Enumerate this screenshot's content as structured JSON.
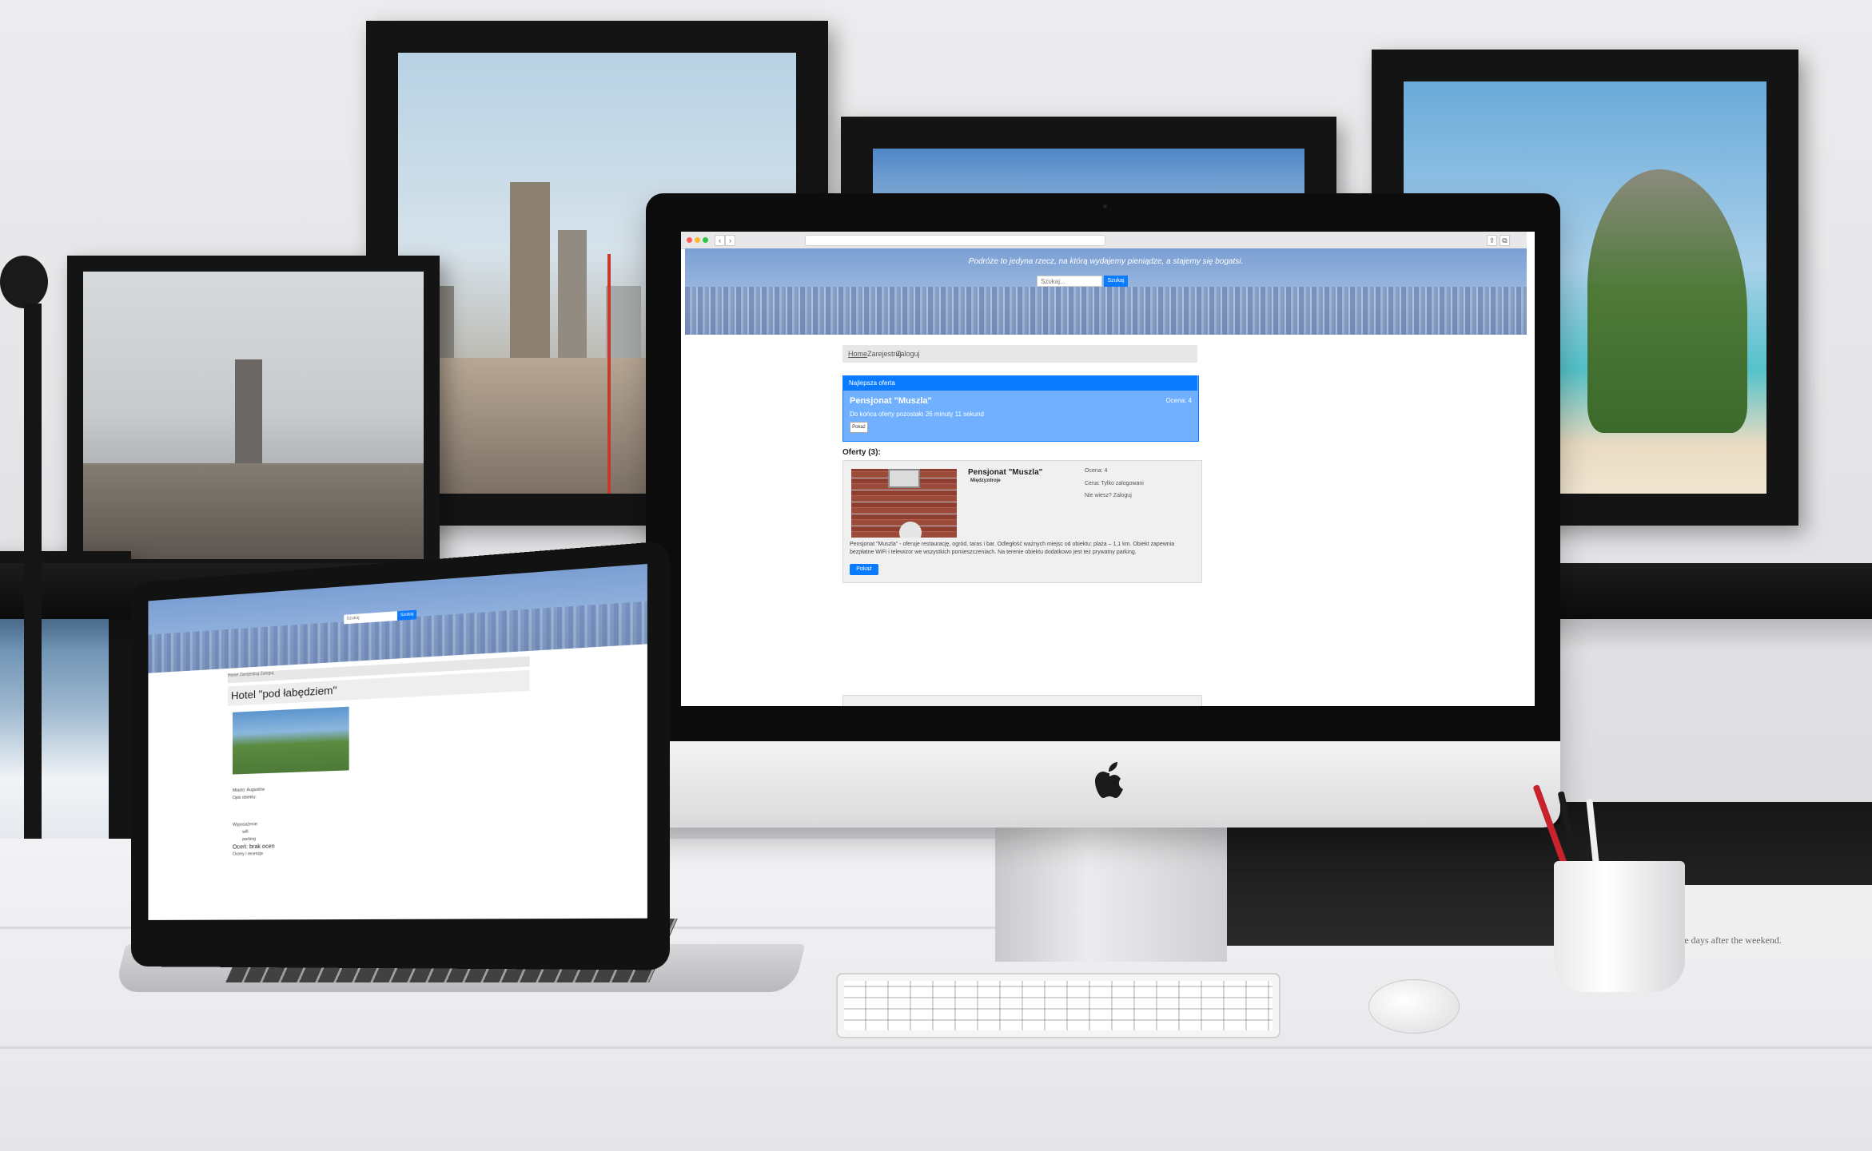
{
  "colors": {
    "primary": "#0a7bff",
    "featured_bg": "#70b0ff",
    "navbar_bg": "#e7e7e7",
    "card_bg": "#f0f0f0",
    "hero_blue": "#7c9fd3"
  },
  "imac": {
    "hero": {
      "tagline": "Podróże to jedyna rzecz, na którą wydajemy pieniądze, a stajemy się bogatsi.",
      "search_placeholder": "Szukaj...",
      "search_button": "Szukaj"
    },
    "nav": {
      "home": "Home",
      "register": "Zarejestruj",
      "login": "Zaloguj"
    },
    "featured": {
      "header": "Najlepsza oferta",
      "title": "Pensjonat \"Muszla\"",
      "rating": "Ocena: 4",
      "countdown": "Do końca oferty pozostało 26 minuty 11 sekund",
      "button": "Pokaż"
    },
    "offers": {
      "heading": "Oferty (3):",
      "items": [
        {
          "title": "Pensjonat \"Muszla\"",
          "location": "Międzyzdroje",
          "rating": "Ocena: 4",
          "price": "Cena: Tylko zalogowani",
          "login_note": "Nie wiesz? Zaloguj",
          "description": "Pensjonat \"Muszla\" - oferuje restaurację, ogród, taras i bar. Odległość ważnych miejsc od obiektu: plaża – 1,1 km. Obiekt zapewnia bezpłatne WiFi i telewizor we wszystkich pomieszczeniach. Na terenie obiektu dodatkowo jest też prywatny parking.",
          "button": "Pokaż"
        }
      ]
    }
  },
  "macbook": {
    "hero": {
      "search_placeholder": "Szukaj",
      "search_button": "Szukaj"
    },
    "nav": "Home  Zarejestruj  Zaloguj",
    "title": "Hotel \"pod łabędziem\"",
    "labels": [
      "Miasto: Augustów",
      "Opis obiektu:",
      "Wyposażenie:",
      "Oceny i recenzje"
    ],
    "list_items": [
      "wifi",
      "parking"
    ],
    "rate_link": "Oceń: brak ocen"
  },
  "decor": {
    "book_text": "The days after the weekend."
  }
}
